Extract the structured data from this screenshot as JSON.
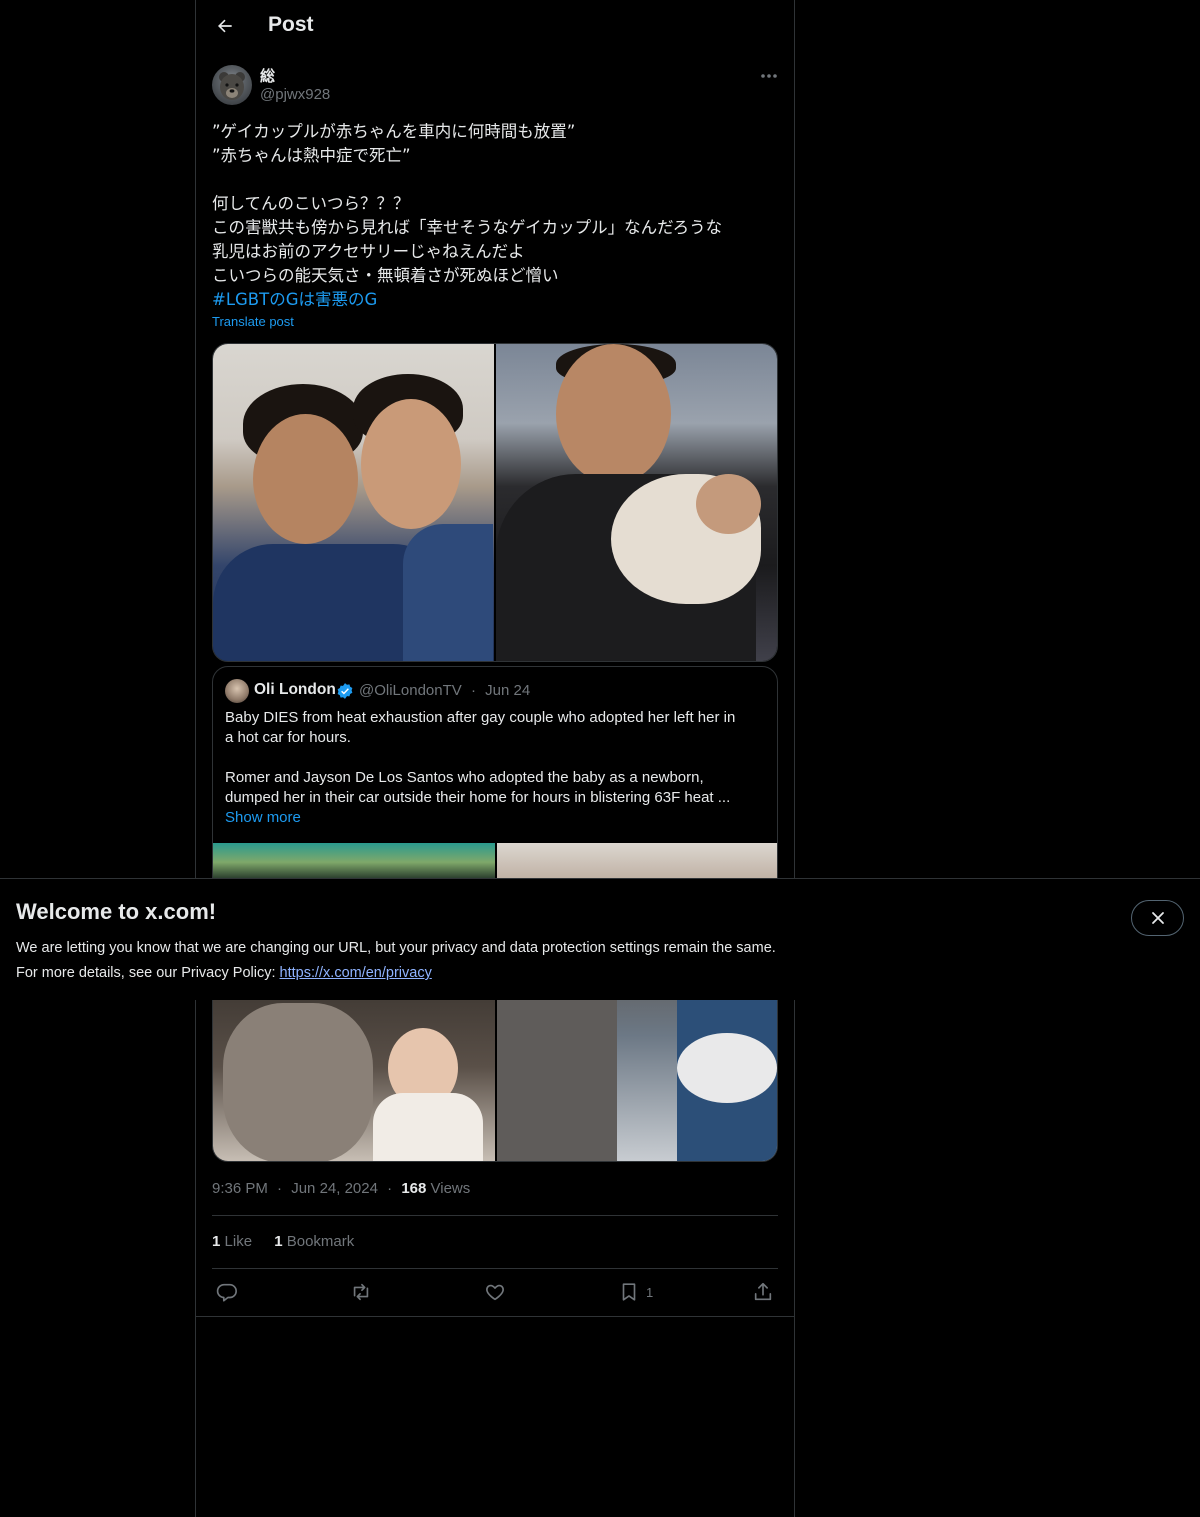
{
  "header": {
    "title": "Post"
  },
  "post": {
    "author": {
      "name": "総",
      "handle": "@pjwx928"
    },
    "lines": [
      "”ゲイカップルが赤ちゃんを車内に何時間も放置”",
      "”赤ちゃんは熱中症で死亡”",
      "",
      "何してんのこいつら？？？",
      "この害獣共も傍から見れば「幸せそうなゲイカップル」なんだろうな",
      "乳児はお前のアクセサリーじゃねえんだよ",
      "こいつらの能天気さ・無頓着さが死ぬほど憎い"
    ],
    "hashtag": "#LGBTのGは害悪のG",
    "translate_label": "Translate post"
  },
  "quote": {
    "name": "Oli London",
    "handle": "@OliLondonTV",
    "separator": "·",
    "date": "Jun 24",
    "lines": [
      "Baby DIES from heat exhaustion after gay couple who adopted her left her in",
      "a hot car for hours.",
      "",
      "Romer and Jayson De Los Santos who adopted the baby as a newborn,",
      "dumped her in their car outside their home for hours in blistering 63F heat ..."
    ],
    "show_more": "Show more"
  },
  "meta": {
    "time": "9:36 PM",
    "separator": "·",
    "date": "Jun 24, 2024",
    "views_count": "168",
    "views_label": "Views"
  },
  "stats": {
    "likes_count": "1",
    "likes_label": "Like",
    "bookmarks_count": "1",
    "bookmarks_label": "Bookmark"
  },
  "actions": {
    "reply_icon": "reply-icon",
    "repost_icon": "repost-icon",
    "like_icon": "heart-icon",
    "bookmark_icon": "bookmark-icon",
    "bookmark_count": "1",
    "share_icon": "share-icon"
  },
  "banner": {
    "title": "Welcome to x.com!",
    "line1": "We are letting you know that we are changing our URL, but your privacy and data protection settings remain the same.",
    "line2_prefix": "For more details, see our Privacy Policy: ",
    "link": "https://x.com/en/privacy"
  },
  "colors": {
    "background": "#000000",
    "text": "#e7e9ea",
    "muted": "#71767b",
    "accent": "#1d9bf0",
    "border": "#2f3336",
    "verified": "#1d9bf0"
  }
}
